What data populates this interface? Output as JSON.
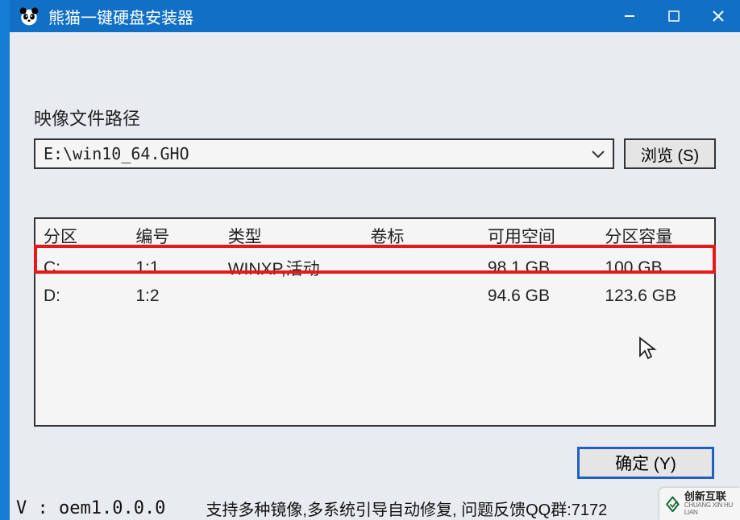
{
  "titlebar": {
    "title": "熊猫一键硬盘安装器",
    "icons": {
      "app": "panda-icon",
      "minimize": "minimize-icon",
      "maximize": "maximize-icon",
      "close": "close-icon"
    }
  },
  "labels": {
    "image_path": "映像文件路径",
    "browse": "浏览 (S)",
    "ok": "确定 (Y)"
  },
  "path": {
    "value": "E:\\win10_64.GHO"
  },
  "table": {
    "headers": {
      "partition": "分区",
      "number": "编号",
      "type": "类型",
      "label": "卷标",
      "free": "可用空间",
      "capacity": "分区容量"
    },
    "rows": [
      {
        "partition": "C:",
        "number": "1:1",
        "type": "WINXP,活动",
        "label": "",
        "free": "98.1 GB",
        "capacity": "100 GB",
        "highlighted": true
      },
      {
        "partition": "D:",
        "number": "1:2",
        "type": "",
        "label": "",
        "free": "94.6 GB",
        "capacity": "123.6 GB",
        "highlighted": false
      }
    ]
  },
  "footer": {
    "version": "V : oem1.0.0.0",
    "message": "支持多种镜像,多系统引导自动修复, 问题反馈QQ群:7172"
  },
  "watermark": {
    "cn": "创新互联",
    "en": "CHUANG XIN HU LIAN"
  }
}
